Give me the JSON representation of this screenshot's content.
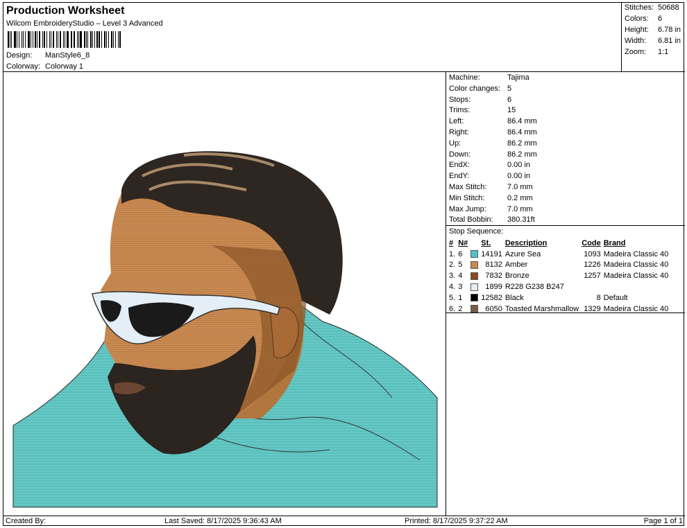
{
  "header": {
    "title": "Production Worksheet",
    "subtitle": "Wilcom EmbroideryStudio – Level 3 Advanced",
    "design_label": "Design:",
    "design_value": "ManStyle6_8",
    "colorway_label": "Colorway:",
    "colorway_value": "Colorway 1"
  },
  "stats": [
    {
      "label": "Stitches:",
      "value": "50688"
    },
    {
      "label": "Colors:",
      "value": "6"
    },
    {
      "label": "Height:",
      "value": "6.78 in"
    },
    {
      "label": "Width:",
      "value": "6.81 in"
    },
    {
      "label": "Zoom:",
      "value": "1:1"
    }
  ],
  "info": [
    {
      "label": "Machine:",
      "value": "Tajima"
    },
    {
      "label": "Color changes:",
      "value": "5"
    },
    {
      "label": "Stops:",
      "value": "6"
    },
    {
      "label": "Trims:",
      "value": "15"
    },
    {
      "label": "Left:",
      "value": "86.4 mm"
    },
    {
      "label": "Right:",
      "value": "86.4 mm"
    },
    {
      "label": "Up:",
      "value": "86.2 mm"
    },
    {
      "label": "Down:",
      "value": "86.2 mm"
    },
    {
      "label": "EndX:",
      "value": "0.00 in"
    },
    {
      "label": "EndY:",
      "value": "0.00 in"
    },
    {
      "label": "Max Stitch:",
      "value": "7.0 mm"
    },
    {
      "label": "Min Stitch:",
      "value": "0.2 mm"
    },
    {
      "label": "Max Jump:",
      "value": "7.0 mm"
    },
    {
      "label": "Total Bobbin:",
      "value": "380.31ft"
    }
  ],
  "stop_sequence": {
    "caption": "Stop Sequence:",
    "headers": {
      "num": "#",
      "n": "N#",
      "st": "St.",
      "desc": "Description",
      "code": "Code",
      "brand": "Brand"
    },
    "rows": [
      {
        "num": "1.",
        "n": "6",
        "color": "#4fc3c8",
        "st": "14191",
        "desc": "Azure Sea",
        "code": "1093",
        "brand": "Madeira Classic 40"
      },
      {
        "num": "2.",
        "n": "5",
        "color": "#c98a52",
        "st": "8132",
        "desc": "Amber",
        "code": "1226",
        "brand": "Madeira Classic 40"
      },
      {
        "num": "3.",
        "n": "4",
        "color": "#8a4a1f",
        "st": "7832",
        "desc": "Bronze",
        "code": "1257",
        "brand": "Madeira Classic 40"
      },
      {
        "num": "4.",
        "n": "3",
        "color": "#e4eef7",
        "st": "1899",
        "desc": "R228 G238 B247",
        "code": "",
        "brand": ""
      },
      {
        "num": "5.",
        "n": "1",
        "color": "#000000",
        "st": "12582",
        "desc": "Black",
        "code": "8",
        "brand": "Default"
      },
      {
        "num": "6.",
        "n": "2",
        "color": "#7a5a4a",
        "st": "6050",
        "desc": "Toasted Marshmallow",
        "code": "1329",
        "brand": "Madeira Classic 40"
      }
    ]
  },
  "footer": {
    "created": "Created By:",
    "last_saved": "Last Saved: 8/17/2025 9:36:43 AM",
    "printed": "Printed: 8/17/2025 9:37:22 AM",
    "page": "Page 1 of 1"
  },
  "colors": {
    "hoodie": "#66c9c6",
    "skin": "#c98a52",
    "skin_shadow": "#8a5526",
    "hair": "#2e2620",
    "hair_highlight": "#a88a68",
    "glasses_frame": "#e4eef7"
  }
}
